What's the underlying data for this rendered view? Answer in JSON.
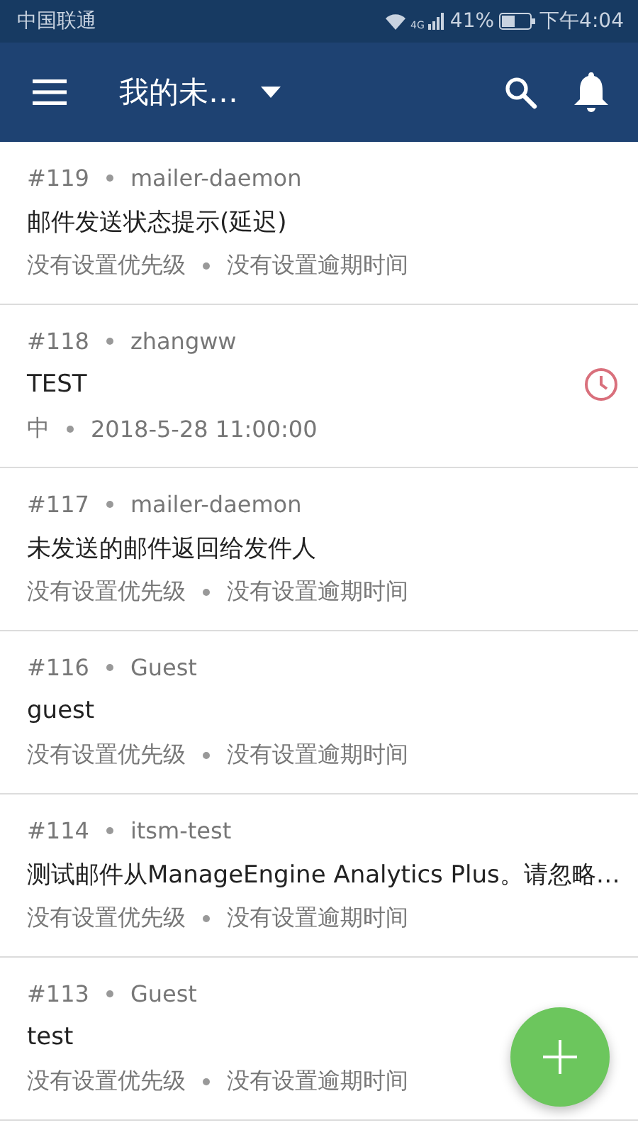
{
  "status_bar": {
    "carrier": "中国联通",
    "network": "4G",
    "battery": "41%",
    "time": "下午4:04"
  },
  "app_bar": {
    "title": "我的未…"
  },
  "tickets": [
    {
      "id": "#119",
      "requester": "mailer-daemon",
      "subject": "邮件发送状态提示(延迟)",
      "priority": "没有设置优先级",
      "due": "没有设置逾期时间",
      "overdue": false
    },
    {
      "id": "#118",
      "requester": "zhangww",
      "subject": "TEST",
      "priority": "中",
      "due": "2018-5-28 11:00:00",
      "overdue": true
    },
    {
      "id": "#117",
      "requester": "mailer-daemon",
      "subject": "未发送的邮件返回给发件人",
      "priority": "没有设置优先级",
      "due": "没有设置逾期时间",
      "overdue": false
    },
    {
      "id": "#116",
      "requester": "Guest",
      "subject": "guest",
      "priority": "没有设置优先级",
      "due": "没有设置逾期时间",
      "overdue": false
    },
    {
      "id": "#114",
      "requester": "itsm-test",
      "subject": "测试邮件从ManageEngine Analytics Plus。请忽略…",
      "priority": "没有设置优先级",
      "due": "没有设置逾期时间",
      "overdue": false
    },
    {
      "id": "#113",
      "requester": "Guest",
      "subject": "test",
      "priority": "没有设置优先级",
      "due": "没有设置逾期时间",
      "overdue": false
    }
  ]
}
